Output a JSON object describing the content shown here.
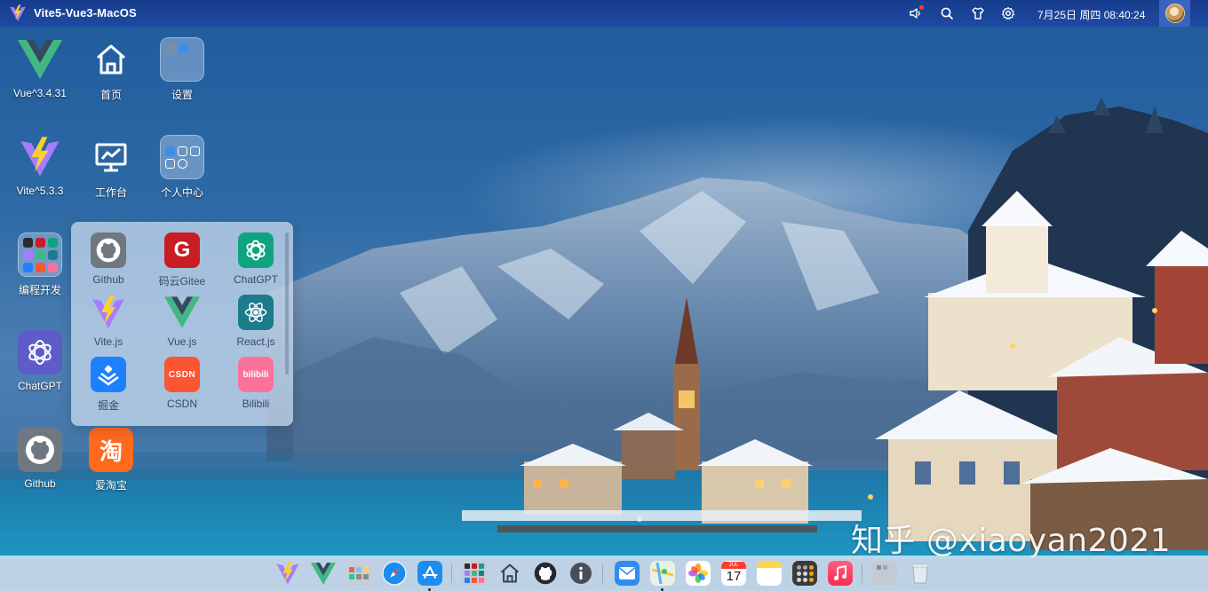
{
  "app": {
    "title": "Vite5-Vue3-MacOS"
  },
  "topbar": {
    "clock": "7月25日 周四 08:40:24",
    "icons": [
      "volume-icon",
      "search-icon",
      "tshirt-icon",
      "gear-icon"
    ]
  },
  "desktop": {
    "icons": [
      {
        "label": "Vue^3.4.31",
        "icon": "vue-logo-icon"
      },
      {
        "label": "首页",
        "icon": "home-icon"
      },
      {
        "label": "设置",
        "icon": "folder-icon"
      },
      {
        "label": "Vite^5.3.3",
        "icon": "vite-logo-icon"
      },
      {
        "label": "工作台",
        "icon": "monitor-icon"
      },
      {
        "label": "个人中心",
        "icon": "folder-icon"
      },
      {
        "label": "编程开发",
        "icon": "folder-icon"
      },
      {
        "label": "ChatGPT",
        "icon": "chatgpt-icon"
      },
      {
        "label": "Github",
        "icon": "github-icon"
      },
      {
        "label": "爱淘宝",
        "icon": "taobao-icon",
        "glyph": "淘"
      }
    ]
  },
  "folder_popup": {
    "apps": [
      {
        "label": "Github",
        "icon": "github-icon"
      },
      {
        "label": "码云Gitee",
        "icon": "gitee-icon",
        "glyph": "G"
      },
      {
        "label": "ChatGPT",
        "icon": "chatgpt-icon"
      },
      {
        "label": "Vite.js",
        "icon": "vite-logo-icon"
      },
      {
        "label": "Vue.js",
        "icon": "vue-logo-icon"
      },
      {
        "label": "React.js",
        "icon": "react-icon"
      },
      {
        "label": "掘金",
        "icon": "juejin-icon"
      },
      {
        "label": "CSDN",
        "icon": "csdn-icon",
        "glyph": "CSDN"
      },
      {
        "label": "Bilibili",
        "icon": "bilibili-icon",
        "glyph": "bilibili"
      }
    ]
  },
  "dock": {
    "items": [
      "vite-logo-icon",
      "vue-logo-icon",
      "launchpad-icon",
      "safari-icon",
      "appstore-icon",
      "apps-folder-icon",
      "home-icon",
      "github-icon",
      "info-icon",
      "mail-icon",
      "maps-icon",
      "photos-icon",
      "calendar-icon",
      "notes-icon",
      "calculator-icon",
      "music-icon",
      "folder-icon",
      "trash-icon"
    ],
    "calendar": {
      "month": "JUL",
      "day": "17"
    }
  },
  "watermark": "知乎 @xiaoyan2021",
  "colors": {
    "topbar": "#1e4aa4",
    "vue_green": "#41b883",
    "vue_dark": "#35495e",
    "gitee_red": "#c71d23",
    "chatgpt_green": "#10a37f",
    "react_teal": "#1c7c8c",
    "juejin_blue": "#1e80ff",
    "csdn_orange": "#fc5531",
    "bilibili_pink": "#fb7299",
    "taobao_orange": "#ff5000"
  }
}
